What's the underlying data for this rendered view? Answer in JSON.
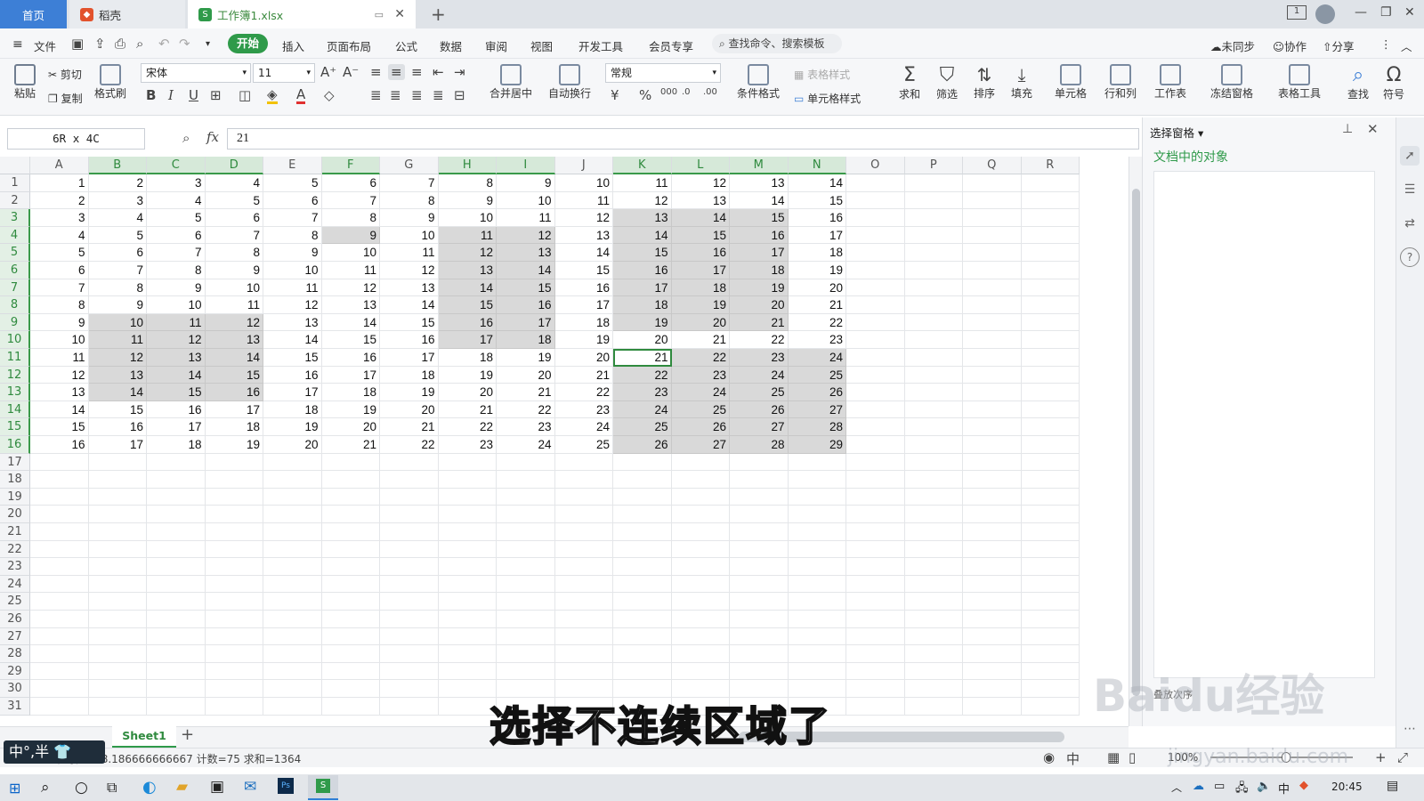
{
  "tabs": {
    "home": "首页",
    "daoke": "稻壳",
    "file": "工作簿1.xlsx",
    "new_tab": "+"
  },
  "menu": {
    "file": "文件",
    "items": [
      "开始",
      "插入",
      "页面布局",
      "公式",
      "数据",
      "审阅",
      "视图",
      "开发工具",
      "会员专享"
    ],
    "search": "查找命令、搜索模板",
    "unsynced": "未同步",
    "collab": "协作",
    "share": "分享"
  },
  "ribbon": {
    "paste": "粘贴",
    "cut": "剪切",
    "copy": "复制",
    "format_painter": "格式刷",
    "font_name": "宋体",
    "font_size": "11",
    "bold": "B",
    "italic": "I",
    "underline": "U",
    "merge": "合并居中",
    "wrap": "自动换行",
    "number_format": "常规",
    "cond_format": "条件格式",
    "table_style": "表格样式",
    "cell_style": "单元格样式",
    "sum": "求和",
    "filter": "筛选",
    "sort": "排序",
    "fill": "填充",
    "cell": "单元格",
    "rowcol": "行和列",
    "worksheet": "工作表",
    "freeze": "冻结窗格",
    "table_tool": "表格工具",
    "find": "查找",
    "symbol": "符号"
  },
  "formula_bar": {
    "name_box": "6R x 4C",
    "fx": "fx",
    "value": "21"
  },
  "grid": {
    "columns": [
      "A",
      "B",
      "C",
      "D",
      "E",
      "F",
      "G",
      "H",
      "I",
      "J",
      "K",
      "L",
      "M",
      "N",
      "O",
      "P",
      "Q",
      "R"
    ],
    "selected_columns": [
      "B",
      "C",
      "D",
      "F",
      "H",
      "I",
      "K",
      "L",
      "M",
      "N"
    ],
    "row_count": 31,
    "selected_rows": [
      3,
      4,
      5,
      6,
      7,
      8,
      9,
      10,
      11,
      12,
      13,
      14,
      15,
      16
    ],
    "data_rows": 16,
    "data_cols": 14,
    "selected_ranges": [
      {
        "r1": 9,
        "r2": 13,
        "c1": 1,
        "c2": 3
      },
      {
        "r1": 4,
        "r2": 4,
        "c1": 5,
        "c2": 5
      },
      {
        "r1": 4,
        "r2": 10,
        "c1": 7,
        "c2": 8
      },
      {
        "r1": 3,
        "r2": 9,
        "c1": 10,
        "c2": 12
      },
      {
        "r1": 11,
        "r2": 16,
        "c1": 10,
        "c2": 13
      }
    ],
    "active_cell": {
      "row": 11,
      "col": 10
    }
  },
  "panel": {
    "title": "选择窗格",
    "subtitle": "文档中的对象",
    "footer": "叠放次序"
  },
  "sheets": {
    "tab": "Sheet1",
    "add": "+"
  },
  "status": {
    "summary": "平均值=18.186666666667  计数=75  求和=1364",
    "zoom": "100%"
  },
  "caption": "选择不连续区域了",
  "watermark": {
    "brand": "Baidu经验",
    "url": "jingyan.baidu.com"
  },
  "ime": {
    "text": "中°,半"
  },
  "taskbar": {
    "time": "20:45"
  }
}
